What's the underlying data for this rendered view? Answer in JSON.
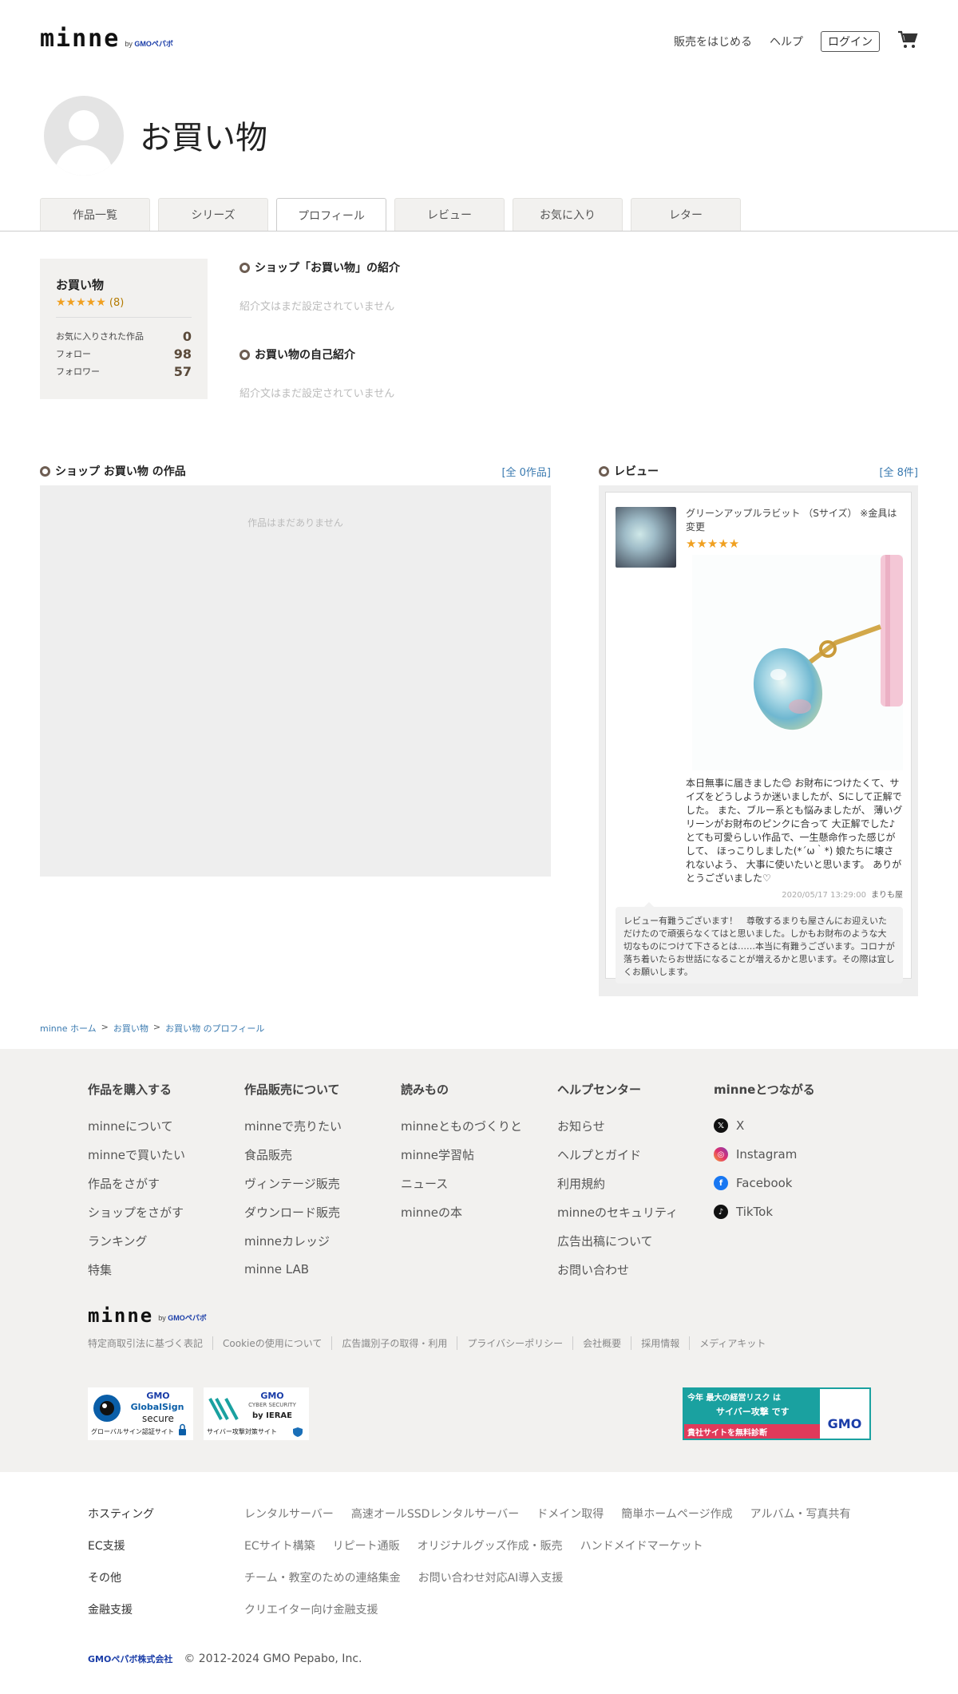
{
  "header": {
    "logo": "minne",
    "logo_sub_prefix": "by",
    "logo_sub_brand": "GMOペパボ",
    "nav": {
      "sell": "販売をはじめる",
      "help": "ヘルプ",
      "login": "ログイン"
    }
  },
  "profile": {
    "title": "お買い物",
    "tabs": [
      "作品一覧",
      "シリーズ",
      "プロフィール",
      "レビュー",
      "お気に入り",
      "レター"
    ],
    "active_tab": "プロフィール",
    "name": "お買い物",
    "rating_stars": "★★★★★",
    "rating_count": "(8)",
    "stats": [
      {
        "label": "お気に入りされた作品",
        "value": "0"
      },
      {
        "label": "フォロー",
        "value": "98"
      },
      {
        "label": "フォロワー",
        "value": "57"
      }
    ]
  },
  "intro": {
    "shop_heading": "ショップ「お買い物」の紹介",
    "shop_empty": "紹介文はまだ設定されていません",
    "self_heading": "お買い物の自己紹介",
    "self_empty": "紹介文はまだ設定されていません"
  },
  "works": {
    "heading": "ショップ お買い物 の作品",
    "link": "[全 0作品]",
    "empty": "作品はまだありません"
  },
  "reviews": {
    "heading": "レビュー",
    "link": "[全 8件]",
    "item": {
      "title": "グリーンアップルラビット （Sサイズ） ※金具は変更",
      "stars": "★★★★★",
      "text": "本日無事に届きました😊 お財布につけたくて、サイズをどうしようか迷いましたが、Sにして正解でした。 また、ブルー系とも悩みましたが、 薄いグリーンがお財布のピンクに合って 大正解でした♪ とても可愛らしい作品で、一生懸命作った感じがして、 ほっこりしました(*´ω｀*) 娘たちに壊されないよう、 大事に使いたいと思います。 ありがとうございました♡",
      "date": "2020/05/17 13:29:00",
      "author": "まりも屋",
      "reply": "レビュー有難うございます！　尊敬するまりも屋さんにお迎えいただけたので頑張らなくてはと思いました。しかもお財布のような大切なものにつけて下さるとは……本当に有難うございます。コロナが落ち着いたらお世話になることが増えるかと思います。その際は宜しくお願いします。"
    }
  },
  "breadcrumb": [
    "minne ホーム",
    "お買い物",
    "お買い物 のプロフィール"
  ],
  "breadcrumb_sep": ">",
  "footer": {
    "columns": [
      {
        "title": "作品を購入する",
        "items": [
          "minneについて",
          "minneで買いたい",
          "作品をさがす",
          "ショップをさがす",
          "ランキング",
          "特集"
        ]
      },
      {
        "title": "作品販売について",
        "items": [
          "minneで売りたい",
          "食品販売",
          "ヴィンテージ販売",
          "ダウンロード販売",
          "minneカレッジ",
          "minne LAB"
        ]
      },
      {
        "title": "読みもの",
        "items": [
          "minneとものづくりと",
          "minne学習帖",
          "ニュース",
          "minneの本"
        ]
      },
      {
        "title": "ヘルプセンター",
        "items": [
          "お知らせ",
          "ヘルプとガイド",
          "利用規約",
          "minneのセキュリティ",
          "広告出稿について",
          "お問い合わせ"
        ]
      }
    ],
    "social": {
      "title": "minneとつながる",
      "items": [
        "X",
        "Instagram",
        "Facebook",
        "TikTok"
      ]
    },
    "links": [
      "特定商取引法に基づく表記",
      "Cookieの使用について",
      "広告識別子の取得・利用",
      "プライバシーポリシー",
      "会社概要",
      "採用情報",
      "メディアキット"
    ],
    "badges": {
      "globalsign_top": "GMO",
      "globalsign_mid": "GlobalSign",
      "globalsign_bottom": "secure",
      "globalsign_caption": "グローバルサイン認証サイト",
      "ierae_top": "GMO",
      "ierae_mid": "CYBER SECURITY",
      "ierae_bottom": "by IERAE",
      "ierae_caption": "サイバー攻撃対策サイト",
      "banner_line1": "今年 最大の経営リスク は",
      "banner_line2": "サイバー攻撃 です",
      "banner_line3": "貴社サイトを無料診断",
      "banner_brand": "GMO"
    }
  },
  "group": {
    "rows": [
      {
        "label": "ホスティング",
        "items": [
          "レンタルサーバー",
          "高速オールSSDレンタルサーバー",
          "ドメイン取得",
          "簡単ホームページ作成",
          "アルバム・写真共有"
        ]
      },
      {
        "label": "EC支援",
        "items": [
          "ECサイト構築",
          "リピート通販",
          "オリジナルグッズ作成・販売",
          "ハンドメイドマーケット"
        ]
      },
      {
        "label": "その他",
        "items": [
          "チーム・教室のための連絡集金",
          "お問い合わせ対応AI導入支援"
        ]
      },
      {
        "label": "金融支援",
        "items": [
          "クリエイター向け金融支援"
        ]
      }
    ],
    "company_logo": "GMOペパボ株式会社",
    "copyright": "© 2012-2024 GMO Pepabo, Inc."
  },
  "colors": {
    "link": "#3a7ab0",
    "star": "#f0a020",
    "footer_bg": "#f2f1ef",
    "accent_ring": "#6d5d52"
  }
}
